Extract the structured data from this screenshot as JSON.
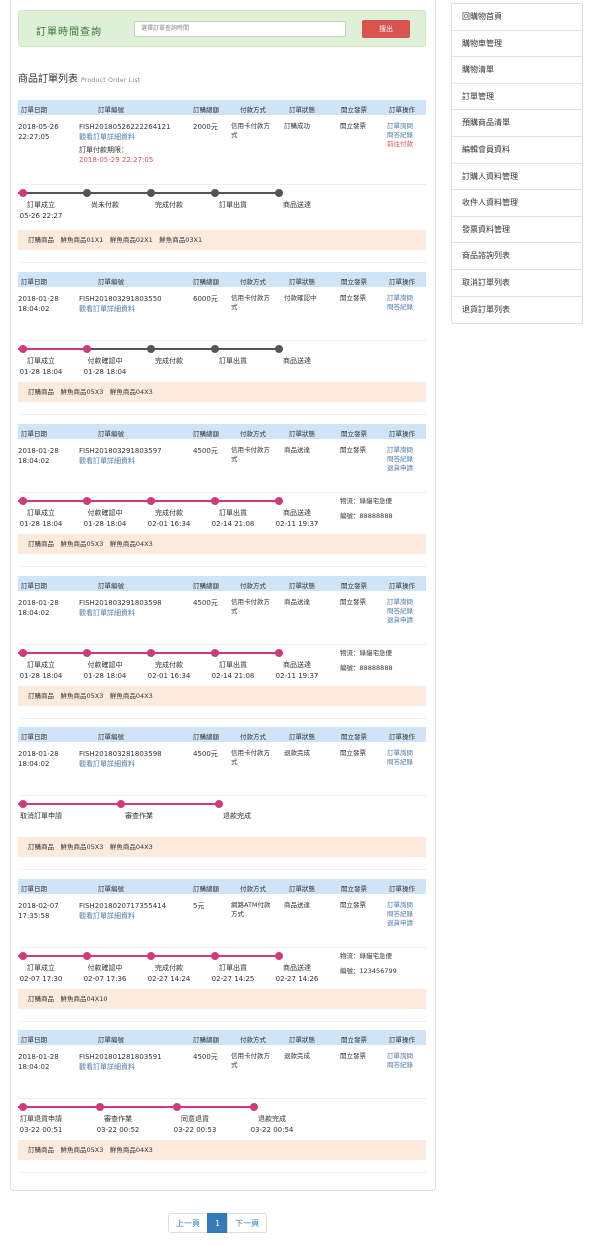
{
  "search": {
    "title": "訂單時間查詢",
    "placeholder": "選擇訂單查詢時間",
    "button": "搜出"
  },
  "list_title": "商品訂單列表",
  "list_subtitle": "Product Order List",
  "headers": [
    "訂單日期",
    "訂單編號",
    "訂購總額",
    "付款方式",
    "訂單狀態",
    "開立發票",
    "訂單操作"
  ],
  "orders": [
    {
      "date": "2018-05-26 22:27:05",
      "order_no": "FISH20180526222264121",
      "detail_link": "觀看訂單詳細資料",
      "total": "2000元",
      "payment": "信用卡付款方式",
      "status": "訂購成功",
      "invoice": "開立發票",
      "actions": [
        "訂單詢問",
        "問答紀錄",
        "前往付款"
      ],
      "extra_label": "訂單付款期限：",
      "extra_value": "2018-05-29 22:27:05",
      "timeline": [
        "訂單成立",
        "尚未付款",
        "完成付款",
        "訂單出貨",
        "商品送達"
      ],
      "timeline_times": [
        "05-26 22:27",
        "",
        "",
        "",
        ""
      ],
      "done": 1,
      "shipping": "",
      "tracking": "",
      "items": "訂購商品　鮮魚商品01X1　鮮魚商品02X1　鮮魚商品03X1"
    },
    {
      "date": "2018-01-28 18:04:02",
      "order_no": "FISH201803291803550",
      "detail_link": "觀看訂單詳細資料",
      "total": "6000元",
      "payment": "信用卡付款方式",
      "status": "付款確認中",
      "invoice": "開立發票",
      "actions": [
        "訂單詢問",
        "問答紀錄"
      ],
      "extra_label": "",
      "extra_value": "",
      "timeline": [
        "訂單成立",
        "付款確認中",
        "完成付款",
        "訂單出貨",
        "商品送達"
      ],
      "timeline_times": [
        "01-28 18:04",
        "01-28 18:04",
        "",
        "",
        ""
      ],
      "done": 2,
      "shipping": "",
      "tracking": "",
      "items": "訂購商品　鮮魚商品05X3　鮮魚商品04X3"
    },
    {
      "date": "2018-01-28 18:04:02",
      "order_no": "FISH201803291803597",
      "detail_link": "觀看訂單詳細資料",
      "total": "4500元",
      "payment": "信用卡付款方式",
      "status": "商品送達",
      "invoice": "開立發票",
      "actions": [
        "訂單詢問",
        "問答紀錄",
        "退貨申請"
      ],
      "extra_label": "",
      "extra_value": "",
      "timeline": [
        "訂單成立",
        "付款確認中",
        "完成付款",
        "訂單出貨",
        "商品送達"
      ],
      "timeline_times": [
        "01-28 18:04",
        "01-28 18:04",
        "02-01 16:34",
        "02-14 21:08",
        "02-11 19:37"
      ],
      "done": 5,
      "shipping": "物流：綠貓宅急便",
      "tracking": "編號：88888888",
      "items": "訂購商品　鮮魚商品05X3　鮮魚商品04X3"
    },
    {
      "date": "2018-01-28 18:04:02",
      "order_no": "FISH201803291803598",
      "detail_link": "觀看訂單詳細資料",
      "total": "4500元",
      "payment": "信用卡付款方式",
      "status": "商品送達",
      "invoice": "開立發票",
      "actions": [
        "訂單詢問",
        "問答紀錄",
        "退貨申請"
      ],
      "extra_label": "",
      "extra_value": "",
      "timeline": [
        "訂單成立",
        "付款確認中",
        "完成付款",
        "訂單出貨",
        "商品送達"
      ],
      "timeline_times": [
        "01-28 18:04",
        "01-28 18:04",
        "02-01 16:34",
        "02-14 21:08",
        "02-11 19:37"
      ],
      "done": 5,
      "shipping": "物流：綠貓宅急便",
      "tracking": "編號：88888888",
      "items": "訂購商品　鮮魚商品05X3　鮮魚商品04X3"
    },
    {
      "date": "2018-01-28 18:04:02",
      "order_no": "FISH201803281803598",
      "detail_link": "觀看訂單詳細資料",
      "total": "4500元",
      "payment": "信用卡付款方式",
      "status": "退款完成",
      "invoice": "開立發票",
      "actions": [
        "訂單詢問",
        "問答紀錄"
      ],
      "extra_label": "",
      "extra_value": "",
      "timeline": [
        "取消訂單申請",
        "審查作業",
        "退款完成"
      ],
      "timeline_times": [
        "",
        "",
        ""
      ],
      "done": 4,
      "shipping": "",
      "tracking": "",
      "items": "訂購商品　鮮魚商品05X3　鮮魚商品04X3"
    },
    {
      "date": "2018-02-07 17:35:58",
      "order_no": "FISH2018020717355414",
      "detail_link": "觀看訂單詳細資料",
      "total": "5元",
      "payment": "網路ATM付款方式",
      "status": "商品送達",
      "invoice": "開立發票",
      "actions": [
        "訂單詢問",
        "問答紀錄",
        "退貨申請"
      ],
      "extra_label": "",
      "extra_value": "",
      "timeline": [
        "訂單成立",
        "付款確認中",
        "完成付款",
        "訂單出貨",
        "商品送達"
      ],
      "timeline_times": [
        "02-07 17:30",
        "02-07 17:36",
        "02-27 14:24",
        "02-27 14:25",
        "02-27 14:26"
      ],
      "done": 5,
      "shipping": "物流：綠貓宅急便",
      "tracking": "編號：123456799",
      "items": "訂購商品　鮮魚商品04X10"
    },
    {
      "date": "2018-01-28 18:04:02",
      "order_no": "FISH201801281803591",
      "detail_link": "觀看訂單詳細資料",
      "total": "4500元",
      "payment": "信用卡付款方式",
      "status": "退款完成",
      "invoice": "開立發票",
      "actions": [
        "訂單詢問",
        "問答紀錄"
      ],
      "extra_label": "",
      "extra_value": "",
      "timeline": [
        "訂單退貨申請",
        "審查作業",
        "同意退貨",
        "退款完成"
      ],
      "timeline_times": [
        "03-22 00:51",
        "03-22 00:52",
        "03-22 00:53",
        "03-22 00:54"
      ],
      "done": 5,
      "shipping": "",
      "tracking": "",
      "items": "訂購商品　鮮魚商品05X3　鮮魚商品04X3"
    }
  ],
  "sidebar": {
    "items": [
      "回購物首頁",
      "購物車管理",
      "購物清單",
      "訂單管理",
      "預購商品清單",
      "編輯會員資料",
      "訂購人資料管理",
      "收件人資料管理",
      "發票資料管理",
      "商品諮詢列表",
      "取消訂單列表",
      "退貨訂單列表"
    ]
  },
  "pagination": {
    "prev": "上一頁",
    "current": "1",
    "next": "下一頁"
  },
  "colors": {
    "timeline_done": "#d03a7d",
    "timeline_todo": "#555555",
    "header_bg": "#cfe4f7",
    "items_bg": "#fcebdc"
  }
}
